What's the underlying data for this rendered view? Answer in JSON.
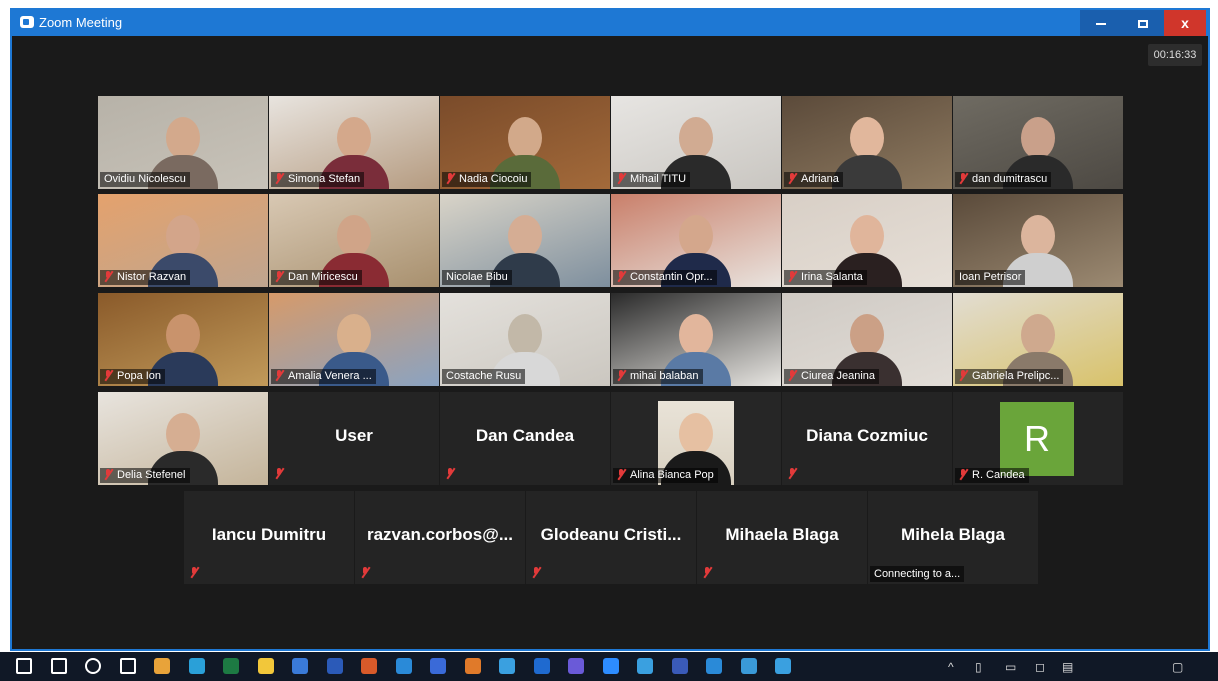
{
  "window": {
    "title": "Zoom Meeting",
    "min_label": "",
    "max_label": "",
    "close_label": "x"
  },
  "meeting": {
    "timer": "00:16:33"
  },
  "participants": [
    {
      "name": "Ovidiu Nicolescu"
    },
    {
      "name": "Simona Stefan"
    },
    {
      "name": "Nadia Ciocoiu"
    },
    {
      "name": "Mihail TITU"
    },
    {
      "name": "Adriana"
    },
    {
      "name": "dan dumitrascu"
    },
    {
      "name": "Nistor Razvan"
    },
    {
      "name": "Dan Miricescu"
    },
    {
      "name": "Nicolae Bibu"
    },
    {
      "name": "Constantin Opr..."
    },
    {
      "name": "Irina Salanta"
    },
    {
      "name": "Ioan Petrisor"
    },
    {
      "name": "Popa Ion"
    },
    {
      "name": "Amalia Venera ..."
    },
    {
      "name": "Costache Rusu"
    },
    {
      "name": "mihai balaban"
    },
    {
      "name": "Ciurea Jeanina"
    },
    {
      "name": "Gabriela Prelipc..."
    },
    {
      "name": "Delia Stefenel"
    },
    {
      "name": "User"
    },
    {
      "name": "Dan Candea"
    },
    {
      "name": "Alina Bianca Pop"
    },
    {
      "name": "Diana Cozmiuc"
    },
    {
      "name": "R. Candea",
      "avatar_letter": "R"
    },
    {
      "name": "Iancu Dumitru"
    },
    {
      "name": "razvan.corbos@..."
    },
    {
      "name": "Glodeanu Cristi..."
    },
    {
      "name": "Mihaela Blaga"
    },
    {
      "name": "Mihela Blaga",
      "status": "Connecting to a..."
    }
  ],
  "colors": {
    "titlebar": "#1e78d4",
    "active_speaker": "#b6d94b",
    "muted": "#e23a3a",
    "avatar_bg": "#6aa53a"
  },
  "taskbar": {
    "icons": [
      "windows-start-icon",
      "search-icon",
      "cortana-icon",
      "task-view-icon",
      "chrome-icon",
      "edge-icon",
      "excel-icon",
      "file-explorer-icon",
      "app-icon",
      "word-icon",
      "app-icon",
      "photos-icon",
      "calendar-icon",
      "firefox-icon",
      "app-icon",
      "mail-icon",
      "teams-icon",
      "zoom-icon",
      "app-icon",
      "app-icon",
      "app-icon",
      "app-icon",
      "app-icon"
    ]
  }
}
